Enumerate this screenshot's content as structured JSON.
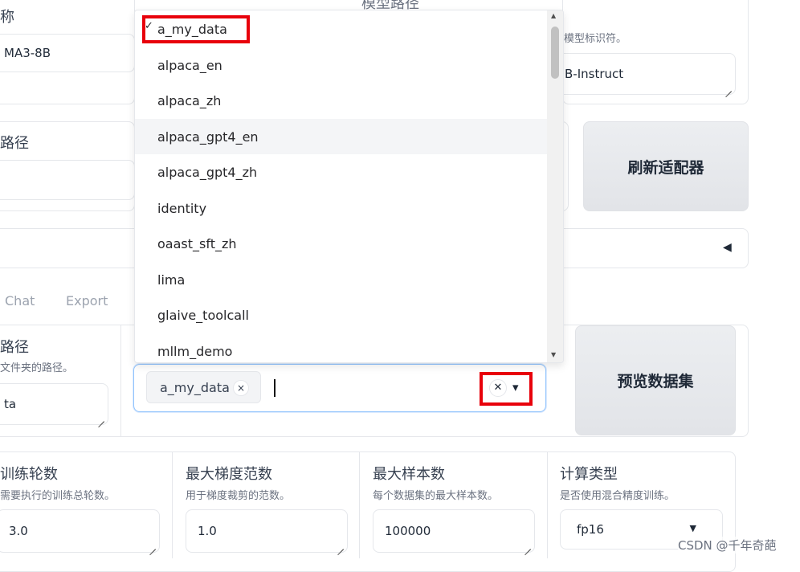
{
  "top_left": {
    "model_name_label": "称",
    "model_name_value": "MA3-8B",
    "path_label": "路径"
  },
  "top_right": {
    "path_header": "模型路径",
    "path_hint": "模型标识符。",
    "path_value": "B-Instruct",
    "refresh_button": "刷新适配器",
    "collapse_icon": "◀"
  },
  "tabs": [
    {
      "label": "Chat"
    },
    {
      "label": "Export"
    }
  ],
  "dataset_section": {
    "dir_label": "路径",
    "dir_hint": "文件夹的路径。",
    "dir_value": "ta",
    "selected_chip": "a_my_data",
    "chip_remove": "×",
    "clear_icon": "✕",
    "dropdown_arrow": "▾",
    "preview_button": "预览数据集"
  },
  "dropdown": {
    "items": [
      {
        "label": "a_my_data"
      },
      {
        "label": "alpaca_en"
      },
      {
        "label": "alpaca_zh"
      },
      {
        "label": "alpaca_gpt4_en"
      },
      {
        "label": "alpaca_gpt4_zh"
      },
      {
        "label": "identity"
      },
      {
        "label": "oaast_sft_zh"
      },
      {
        "label": "lima"
      },
      {
        "label": "glaive_toolcall"
      },
      {
        "label": "mllm_demo"
      }
    ],
    "check_mark": "✓",
    "scroll_up": "▲",
    "scroll_down": "▼"
  },
  "params": {
    "epochs": {
      "label": "训练轮数",
      "hint": "需要执行的训练总轮数。",
      "value": "3.0"
    },
    "grad_norm": {
      "label": "最大梯度范数",
      "hint": "用于梯度裁剪的范数。",
      "value": "1.0"
    },
    "max_samples": {
      "label": "最大样本数",
      "hint": "每个数据集的最大样本数。",
      "value": "100000"
    },
    "compute_type": {
      "label": "计算类型",
      "hint": "是否使用混合精度训练。",
      "value": "fp16",
      "arrow": "▼"
    }
  },
  "watermark": "CSDN @千年奇葩",
  "colors": {
    "highlight_red": "#e8000b",
    "focus_blue": "#93c5fd"
  }
}
